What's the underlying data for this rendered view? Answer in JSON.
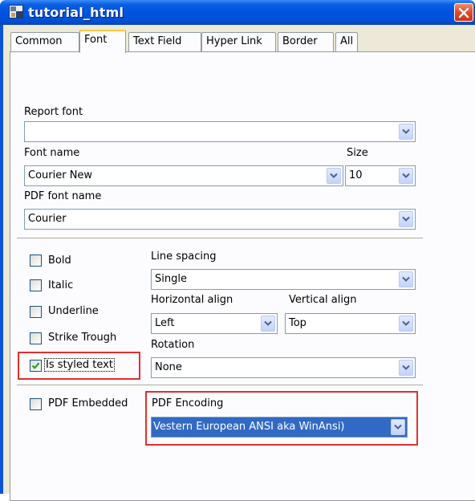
{
  "window": {
    "title": "tutorial_html"
  },
  "tabs": [
    {
      "label": "Common"
    },
    {
      "label": "Font",
      "active": true
    },
    {
      "label": "Text Field"
    },
    {
      "label": "Hyper Link"
    },
    {
      "label": "Border"
    },
    {
      "label": "All"
    }
  ],
  "font": {
    "report_font_label": "Report font",
    "report_font_value": "",
    "font_name_label": "Font name",
    "font_name_value": "Courier New",
    "size_label": "Size",
    "size_value": "10",
    "pdf_font_name_label": "PDF font name",
    "pdf_font_name_value": "Courier"
  },
  "styles": {
    "bold": {
      "label": "Bold",
      "checked": false
    },
    "italic": {
      "label": "Italic",
      "checked": false
    },
    "underline": {
      "label": "Underline",
      "checked": false
    },
    "strike": {
      "label": "Strike Trough",
      "checked": false
    },
    "styled_text": {
      "label": "Is styled text",
      "checked": true
    }
  },
  "paragraph": {
    "line_spacing_label": "Line spacing",
    "line_spacing_value": "Single",
    "h_align_label": "Horizontal align",
    "h_align_value": "Left",
    "v_align_label": "Vertical align",
    "v_align_value": "Top",
    "rotation_label": "Rotation",
    "rotation_value": "None"
  },
  "pdf": {
    "embedded_label": "PDF Embedded",
    "embedded_checked": false,
    "encoding_label": "PDF Encoding",
    "encoding_value": "Vestern European ANSI aka WinAnsi)"
  },
  "colors": {
    "titlebar": "#0054e3",
    "dialog": "#ece9d8",
    "highlight": "#316ac5",
    "annotation": "#e03030"
  }
}
